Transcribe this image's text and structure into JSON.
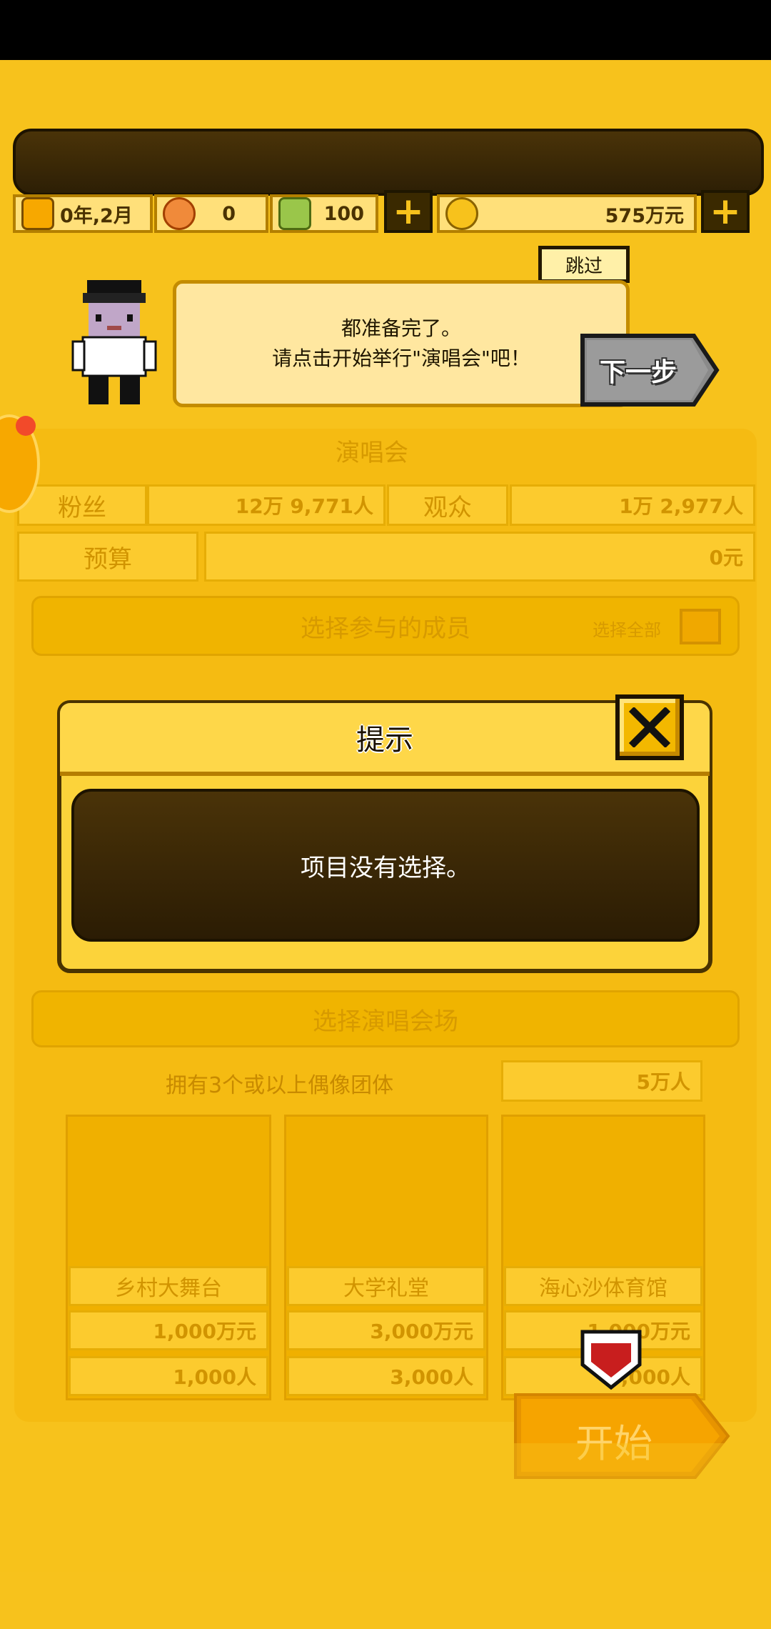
{
  "header": {
    "date": "0年,2月",
    "resource_a": "0",
    "resource_b": "100",
    "money": "575万元"
  },
  "tutorial": {
    "skip_label": "跳过",
    "line1": "都准备完了。",
    "line2": "请点击开始举行\"演唱会\"吧！",
    "next_label": "下一步"
  },
  "concert": {
    "section_title": "演唱会",
    "fans_label": "粉丝",
    "fans_value": "12万 9,771人",
    "audience_label": "观众",
    "audience_value": "1万 2,977人",
    "budget_label": "预算",
    "budget_value": "0元",
    "select_members_title": "选择参与的成员",
    "select_all_label": "选择全部",
    "select_venue_title": "选择演唱会场",
    "venue_condition": "拥有3个或以上偶像团体",
    "venue_capacity_top": "5万人",
    "venues": [
      {
        "name": "乡村大舞台",
        "cost": "1,000万元",
        "capacity": "1,000人"
      },
      {
        "name": "大学礼堂",
        "cost": "3,000万元",
        "capacity": "3,000人"
      },
      {
        "name": "海心沙体育馆",
        "cost": "1,000万元",
        "capacity": "5,000人"
      }
    ]
  },
  "modal": {
    "title": "提示",
    "message": "项目没有选择。"
  },
  "start_label": "开始",
  "colors": {
    "background": "#f7c21c",
    "dark_panel": "#3a2904",
    "start_button": "#f9a000"
  }
}
